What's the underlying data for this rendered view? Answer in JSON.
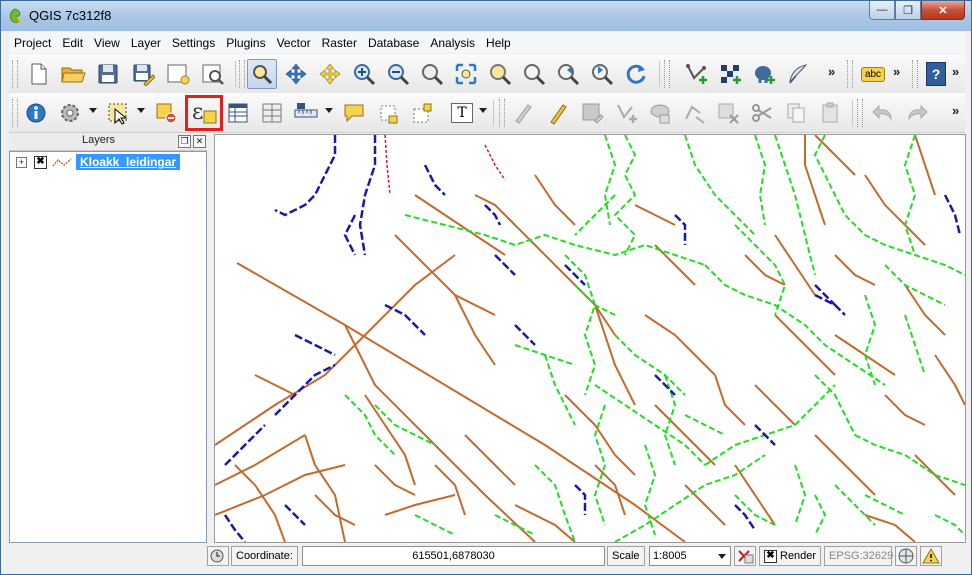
{
  "window": {
    "title": "QGIS 7c312f8",
    "min_label": "—",
    "max_label": "❐",
    "close_label": "✕"
  },
  "menu": [
    "Project",
    "Edit",
    "View",
    "Layer",
    "Settings",
    "Plugins",
    "Vector",
    "Raster",
    "Database",
    "Analysis",
    "Help"
  ],
  "toolbar": {
    "overflow": "»",
    "label_tool_text": "abc",
    "help_text": "?",
    "text_annotation": "T"
  },
  "layers_panel": {
    "title": "Layers",
    "float_label": "❐",
    "close_label": "✕",
    "items": [
      {
        "name": "Kloakk_leidingar",
        "visible_mark": "✖",
        "expand_mark": "+"
      }
    ]
  },
  "statusbar": {
    "coordinate_label": "Coordinate:",
    "coordinate_value": "615501,6878030",
    "scale_label": "Scale",
    "scale_value": "1:8005",
    "render_label": "Render",
    "render_mark": "✖",
    "crs_label": "EPSG:32629"
  },
  "colors": {
    "sewer_brown": "#c46a2c",
    "sewer_green": "#22dd22",
    "sewer_blue": "#1a1aa8",
    "selected_layer": "#3399ff",
    "highlight_box": "#e02020"
  }
}
